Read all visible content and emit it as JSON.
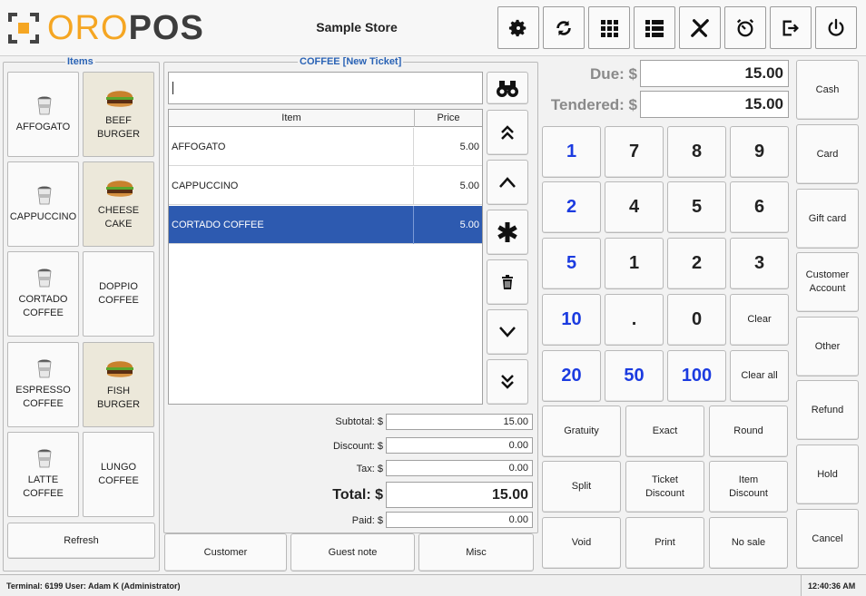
{
  "header": {
    "logo_oro": "ORO",
    "logo_pos": "POS",
    "store_name": "Sample Store",
    "buttons": [
      "settings-icon",
      "refresh-icon",
      "grid-icon",
      "list-icon",
      "tools-icon",
      "timer-icon",
      "logout-icon",
      "power-icon"
    ]
  },
  "items_panel": {
    "title": "Items",
    "items": [
      {
        "label": "AFFOGATO",
        "icon": "coffee-cup-icon"
      },
      {
        "label": "BEEF\nBURGER",
        "icon": "burger-icon"
      },
      {
        "label": "CAPPUCCINO",
        "icon": "coffee-cup-icon"
      },
      {
        "label": "CHEESE\nCAKE",
        "icon": "burger-icon"
      },
      {
        "label": "CORTADO\nCOFFEE",
        "icon": "coffee-cup-icon"
      },
      {
        "label": "DOPPIO\nCOFFEE",
        "icon": ""
      },
      {
        "label": "ESPRESSO\nCOFFEE",
        "icon": "coffee-cup-icon"
      },
      {
        "label": "FISH\nBURGER",
        "icon": "burger-icon"
      },
      {
        "label": "LATTE\nCOFFEE",
        "icon": "coffee-cup-icon"
      },
      {
        "label": "LUNGO\nCOFFEE",
        "icon": ""
      }
    ],
    "refresh_label": "Refresh"
  },
  "ticket": {
    "title": "COFFEE [New Ticket]",
    "search_value": "",
    "col_item": "Item",
    "col_price": "Price",
    "rows": [
      {
        "item": "AFFOGATO",
        "price": "5.00",
        "selected": false
      },
      {
        "item": "CAPPUCCINO",
        "price": "5.00",
        "selected": false
      },
      {
        "item": "CORTADO COFFEE",
        "price": "5.00",
        "selected": true
      }
    ],
    "subtotal_label": "Subtotal: $",
    "subtotal": "15.00",
    "discount_label": "Discount: $",
    "discount": "0.00",
    "tax_label": "Tax: $",
    "tax": "0.00",
    "total_label": "Total: $",
    "total": "15.00",
    "paid_label": "Paid: $",
    "paid": "0.00",
    "customer_label": "Customer",
    "guest_note_label": "Guest note",
    "misc_label": "Misc"
  },
  "payment": {
    "due_label": "Due: $",
    "due": "15.00",
    "tendered_label": "Tendered: $",
    "tendered": "15.00",
    "keypad": [
      [
        "1",
        "7",
        "8",
        "9"
      ],
      [
        "2",
        "4",
        "5",
        "6"
      ],
      [
        "5",
        "1",
        "2",
        "3"
      ],
      [
        "10",
        ".",
        "0",
        "Clear"
      ],
      [
        "20",
        "50",
        "100",
        "Clear all"
      ]
    ],
    "action_rows": [
      [
        "Gratuity",
        "Exact",
        "Round"
      ],
      [
        "Split",
        "Ticket\nDiscount",
        "Item\nDiscount"
      ],
      [
        "Void",
        "Print",
        "No sale"
      ]
    ],
    "side_buttons": [
      "Cash",
      "Card",
      "Gift card",
      "Customer\nAccount",
      "Other",
      "Refund",
      "Hold",
      "Cancel"
    ]
  },
  "status_bar": {
    "terminal": "Terminal: 6199 User: Adam K (Administrator)",
    "time": "12:40:36 AM"
  }
}
